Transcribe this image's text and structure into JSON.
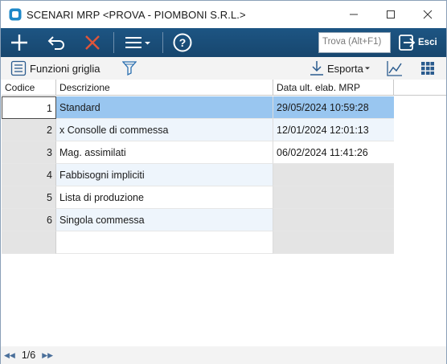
{
  "window": {
    "title": "SCENARI MRP <PROVA - PIOMBONI S.R.L.>"
  },
  "toolbar": {
    "new_icon": "plus-icon",
    "undo_icon": "undo-icon",
    "delete_icon": "x-icon",
    "menu_icon": "hamburger-menu-icon",
    "help_icon": "help-icon",
    "find_placeholder": "Trova (Alt+F1)",
    "exit_label": "Esci"
  },
  "subbar": {
    "grid_functions_label": "Funzioni griglia",
    "filter_icon": "filter-icon",
    "export_label": "Esporta",
    "chart_icon": "chart-icon",
    "grid_icon": "grid-icon"
  },
  "grid": {
    "columns": [
      "Codice",
      "Descrizione",
      "Data ult. elab. MRP"
    ],
    "rows": [
      {
        "code": "1",
        "description": "Standard",
        "date": "29/05/2024 10:59:28"
      },
      {
        "code": "2",
        "description": "x Consolle di commessa",
        "date": "12/01/2024 12:01:13"
      },
      {
        "code": "3",
        "description": "Mag. assimilati",
        "date": "06/02/2024 11:41:26"
      },
      {
        "code": "4",
        "description": "Fabbisogni impliciti",
        "date": ""
      },
      {
        "code": "5",
        "description": "Lista di produzione",
        "date": ""
      },
      {
        "code": "6",
        "description": "Singola commessa",
        "date": ""
      }
    ]
  },
  "status": {
    "pager": "1/6"
  },
  "colors": {
    "toolbar_bg": "#1d5583",
    "selection": "#99c6f0",
    "alt_row": "#eef5fc",
    "delete_red": "#e0553a"
  }
}
